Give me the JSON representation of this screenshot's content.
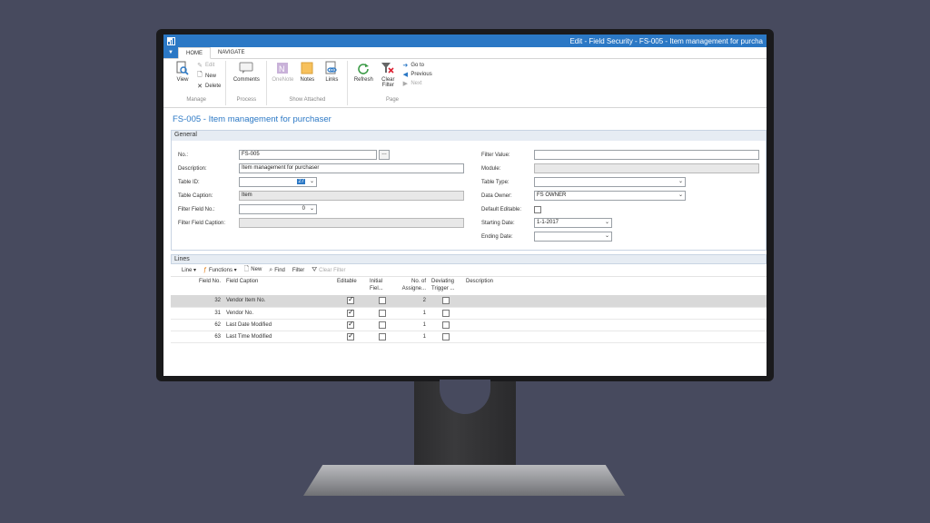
{
  "window": {
    "title": "Edit - Field Security - FS-005 - Item management for purcha"
  },
  "colors": {
    "accent": "#2b78c5",
    "background": "#474a5e"
  },
  "tabs": [
    {
      "label": "HOME",
      "active": true
    },
    {
      "label": "NAVIGATE",
      "active": false
    }
  ],
  "ribbon": {
    "manage": {
      "label": "Manage",
      "view": "View",
      "edit": "Edit",
      "new": "New",
      "delete": "Delete"
    },
    "process": {
      "label": "Process",
      "comments": "Comments"
    },
    "show_attached": {
      "label": "Show Attached",
      "onenote": "OneNote",
      "notes": "Notes",
      "links": "Links"
    },
    "page": {
      "label": "Page",
      "refresh": "Refresh",
      "clear_filter_1": "Clear",
      "clear_filter_2": "Filter",
      "go_to": "Go to",
      "previous": "Previous",
      "next": "Next"
    }
  },
  "page_title": "FS-005 - Item management for purchaser",
  "general": {
    "header": "General",
    "no_label": "No.:",
    "no_value": "FS-005",
    "description_label": "Description:",
    "description_value": "Item management for purchaser",
    "table_id_label": "Table ID:",
    "table_id_value": "27",
    "table_caption_label": "Table Caption:",
    "table_caption_value": "Item",
    "filter_field_no_label": "Filter Field No.:",
    "filter_field_no_value": "0",
    "filter_field_caption_label": "Filter Field Caption:",
    "filter_field_caption_value": "",
    "filter_value_label": "Filter Value:",
    "filter_value_value": "",
    "module_label": "Module:",
    "module_value": "",
    "table_type_label": "Table Type:",
    "table_type_value": "",
    "data_owner_label": "Data Owner:",
    "data_owner_value": "FS OWNER",
    "default_editable_label": "Default Editable:",
    "default_editable_checked": false,
    "starting_date_label": "Starting Date:",
    "starting_date_value": "1-1-2017",
    "ending_date_label": "Ending Date:",
    "ending_date_value": ""
  },
  "lines": {
    "header": "Lines",
    "toolbar": {
      "line": "Line",
      "functions": "Functions",
      "new": "New",
      "find": "Find",
      "filter": "Filter",
      "clear_filter": "Clear Filter"
    },
    "columns": {
      "field_no": "Field No.",
      "field_caption": "Field Caption",
      "editable": "Editable",
      "initial_1": "Initial",
      "initial_2": "Fiel...",
      "no_assigned_1": "No. of",
      "no_assigned_2": "Assigne...",
      "deviating_1": "Deviating",
      "deviating_2": "Trigger ...",
      "description": "Description"
    },
    "rows": [
      {
        "field_no": "32",
        "field_caption": "Vendor Item No.",
        "editable": true,
        "initial": false,
        "no_assigned": "2",
        "deviating": false,
        "description": "",
        "selected": true
      },
      {
        "field_no": "31",
        "field_caption": "Vendor No.",
        "editable": true,
        "initial": false,
        "no_assigned": "1",
        "deviating": false,
        "description": "",
        "selected": false
      },
      {
        "field_no": "62",
        "field_caption": "Last Date Modified",
        "editable": true,
        "initial": false,
        "no_assigned": "1",
        "deviating": false,
        "description": "",
        "selected": false
      },
      {
        "field_no": "63",
        "field_caption": "Last Time Modified",
        "editable": true,
        "initial": false,
        "no_assigned": "1",
        "deviating": false,
        "description": "",
        "selected": false
      }
    ]
  }
}
